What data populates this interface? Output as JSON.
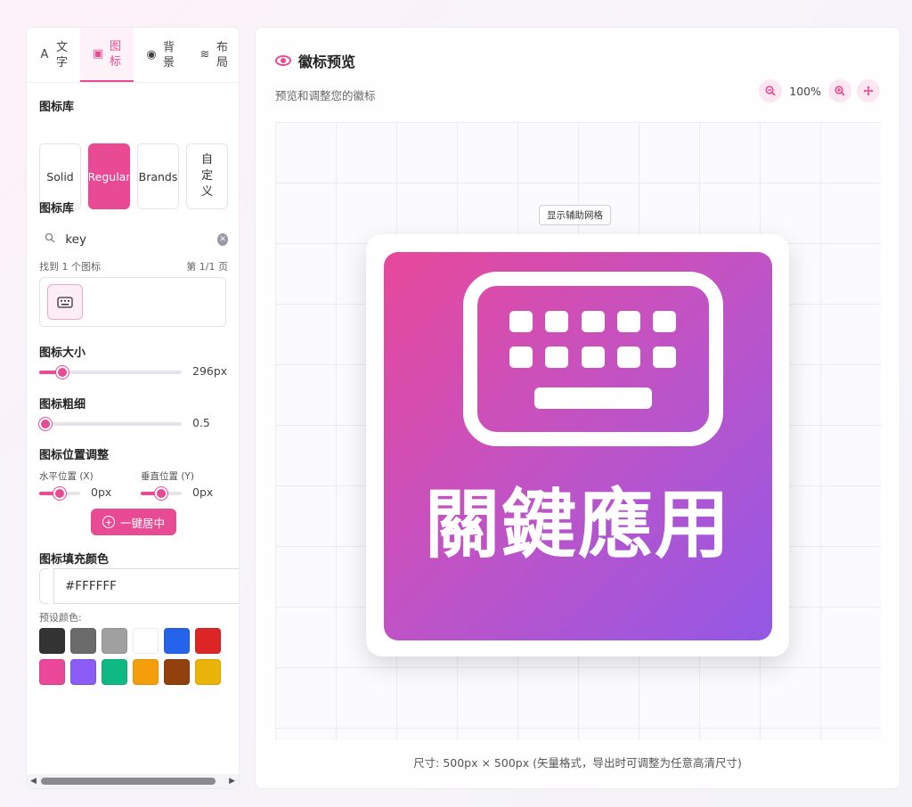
{
  "tabs": [
    {
      "icon": "A",
      "label": "文字"
    },
    {
      "icon": "▣",
      "label": "图标"
    },
    {
      "icon": "◉",
      "label": "背景"
    },
    {
      "icon": "≋",
      "label": "布局"
    }
  ],
  "icon_library": {
    "title": "图标库",
    "buttons": [
      "Solid",
      "Regular",
      "Brands"
    ],
    "custom_label": [
      "自",
      "定",
      "义"
    ],
    "active": "Regular"
  },
  "search": {
    "title": "图标库",
    "value": "key",
    "placeholder": "key",
    "result_count": "找到 1 个图标",
    "page_info": "第 1/1 页"
  },
  "icon_size": {
    "title": "图标大小",
    "value": "296px",
    "fraction": 0.13
  },
  "icon_weight": {
    "title": "图标粗细",
    "value": "0.5",
    "fraction": 0.0
  },
  "position": {
    "title": "图标位置调整",
    "horizontal_label": "水平位置 (X)",
    "horizontal_value": "0px",
    "vertical_label": "垂直位置 (Y)",
    "vertical_value": "0px",
    "center_button": "一键居中"
  },
  "fill_color": {
    "title": "图标填充颜色",
    "value": "#FFFFFF",
    "preset_label": "预设颜色:",
    "presets": [
      "#333333",
      "#6b6b6b",
      "#a0a0a0",
      "#ffffff",
      "#2563eb",
      "#dc2626",
      "#ec4899",
      "#8b5cf6",
      "#10b981",
      "#f59e0b",
      "#92400e",
      "#eab308"
    ]
  },
  "preview": {
    "title": "徽标预览",
    "subtitle": "预览和调整您的徽标",
    "zoom": "100%",
    "grid_toggle": "显示辅助网格",
    "badge_text": "關鍵應用",
    "badge_icon": "keyboard-icon",
    "footer": "尺寸: 500px × 500px (矢量格式，导出时可调整为任意高清尺寸)"
  },
  "colors": {
    "accent": "#e84b93",
    "gradient_start": "#e8489a",
    "gradient_end": "#9358e6"
  }
}
